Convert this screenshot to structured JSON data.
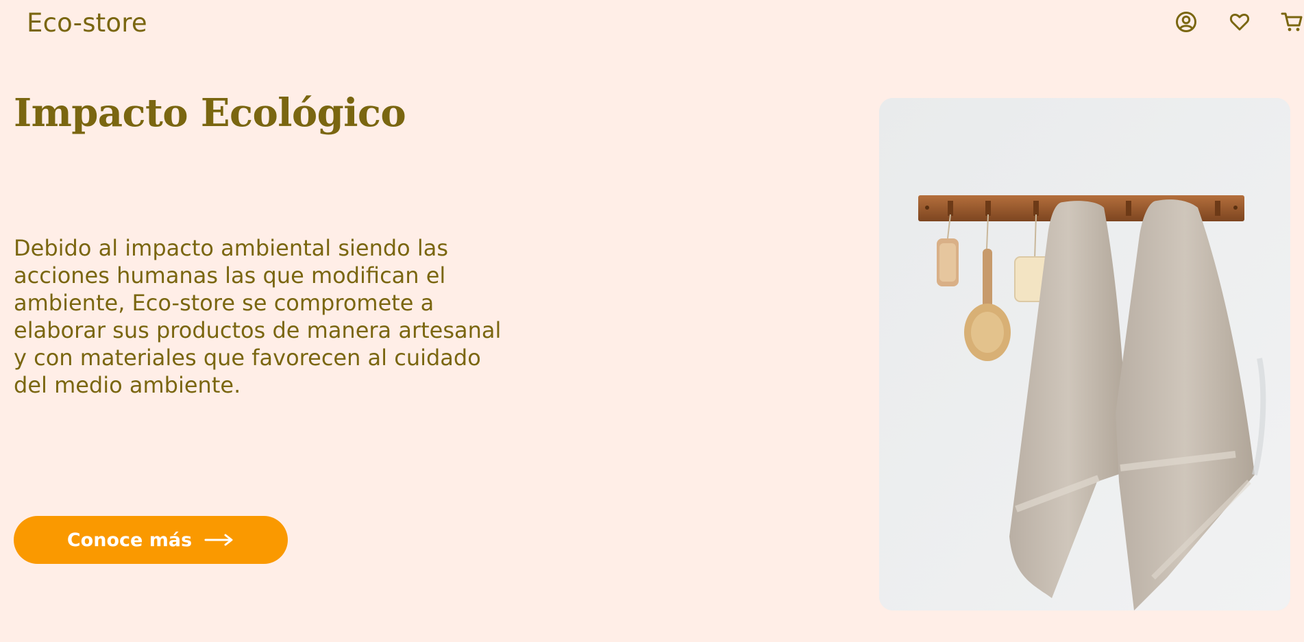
{
  "header": {
    "brand": "Eco-store",
    "icons": [
      "account-icon",
      "heart-icon",
      "cart-icon"
    ]
  },
  "hero": {
    "title": "Impacto Ecológico",
    "description": "Debido al impacto ambiental siendo las acciones humanas las que modifican el ambiente, Eco-store se compromete a elaborar sus productos de manera artesanal y con materiales que favorecen al cuidado del medio ambiente.",
    "cta_label": "Conoce más",
    "cta_icon": "arrow-right-icon",
    "image_subject": "towels-on-wooden-rack-image"
  },
  "colors": {
    "background": "#ffeee7",
    "text": "#7a6610",
    "accent": "#fa9900",
    "button_text": "#ffffff"
  }
}
